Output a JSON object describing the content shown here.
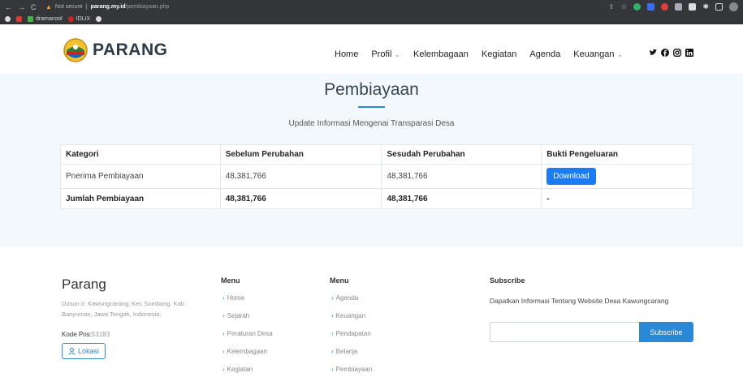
{
  "browser": {
    "security_label": "Not secure",
    "host": "parang.my.id",
    "path": "/pembiayaan.php",
    "bookmarks": [
      "dramacool",
      "IDLIX"
    ]
  },
  "header": {
    "brand": "PARANG",
    "nav": [
      {
        "label": "Home"
      },
      {
        "label": "Profil",
        "dropdown": true
      },
      {
        "label": "Kelembagaan"
      },
      {
        "label": "Kegiatan"
      },
      {
        "label": "Agenda"
      },
      {
        "label": "Keuangan",
        "dropdown": true
      }
    ],
    "social_icons": [
      "twitter-icon",
      "facebook-icon",
      "instagram-icon",
      "linkedin-icon"
    ]
  },
  "main": {
    "title": "Pembiayaan",
    "subtitle": "Update Informasi Mengenai Transparasi Desa",
    "table": {
      "headers": [
        "Kategori",
        "Sebelum Perubahan",
        "Sesudah Perubahan",
        "Bukti Pengeluaran"
      ],
      "rows": [
        {
          "kategori": "Pnerima Pembiayaan",
          "sebelum": "48,381,766",
          "sesudah": "48,381,766",
          "bukti_button": "Download"
        }
      ],
      "total": {
        "kategori": "Jumlah Pembiayaan",
        "sebelum": "48,381,766",
        "sesudah": "48,381,766",
        "bukti": "-"
      }
    }
  },
  "footer": {
    "brand": "Parang",
    "address": "Dusun II, Kawungcarang, Kec Sumbang, Kab Banyumas, Jawa Tengah, Indonesia.",
    "kode_pos_label": "Kode Pos:",
    "kode_pos_value": "53183",
    "lokasi_button": "Lokasi",
    "menu1": {
      "title": "Menu",
      "items": [
        "Home",
        "Sejarah",
        "Peraturan Desa",
        "Kelembagaan",
        "Kegiatan"
      ]
    },
    "menu2": {
      "title": "Menu",
      "items": [
        "Agenda",
        "Keuangan",
        "Pendapatan",
        "Belanja",
        "Pembiayaan"
      ]
    },
    "subscribe": {
      "title": "Subscribe",
      "description": "Dapatkan Informasi Tentang Website Desa Kawungcarang",
      "button": "Subscribe"
    }
  },
  "colors": {
    "accent": "#2a88d8",
    "download": "#1a7cf0",
    "section_bg": "#f3f8fd"
  }
}
